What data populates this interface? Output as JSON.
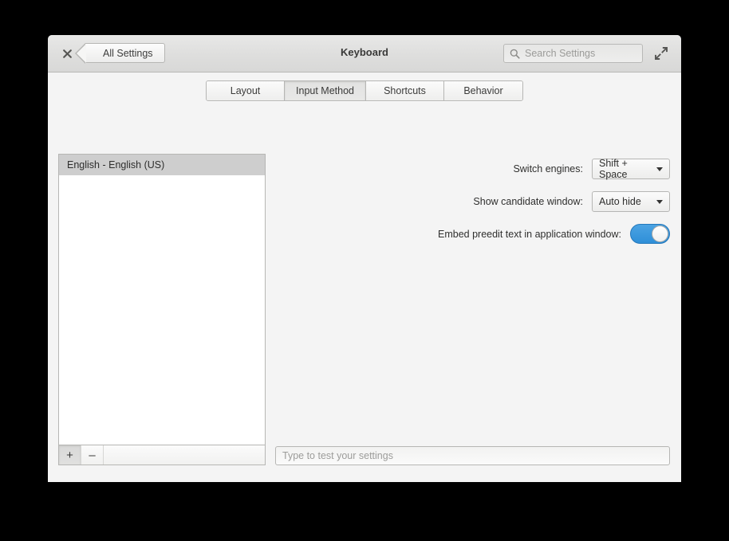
{
  "window": {
    "title": "Keyboard",
    "close_icon": "close-icon",
    "maximize_icon": "maximize-icon",
    "back_label": "All Settings",
    "search": {
      "icon": "search-icon",
      "placeholder": "Search Settings",
      "value": ""
    }
  },
  "tabs": [
    {
      "label": "Layout",
      "selected": false
    },
    {
      "label": "Input Method",
      "selected": true
    },
    {
      "label": "Shortcuts",
      "selected": false
    },
    {
      "label": "Behavior",
      "selected": false
    }
  ],
  "engine_panel": {
    "items": [
      {
        "label": "English - English (US)",
        "selected": true
      }
    ],
    "toolbar": {
      "add_label": "+",
      "remove_label": "–"
    }
  },
  "settings": {
    "switch_engines": {
      "label": "Switch engines:",
      "value": "Shift + Space"
    },
    "candidate_window": {
      "label": "Show candidate window:",
      "value": "Auto hide"
    },
    "embed_preedit": {
      "label": "Embed preedit text in application window:",
      "state": "on"
    }
  },
  "test_entry": {
    "placeholder": "Type to test your settings",
    "value": ""
  },
  "colors": {
    "accent": "#3d9ae2",
    "window_bg": "#f4f4f4",
    "selection": "#cecece"
  }
}
